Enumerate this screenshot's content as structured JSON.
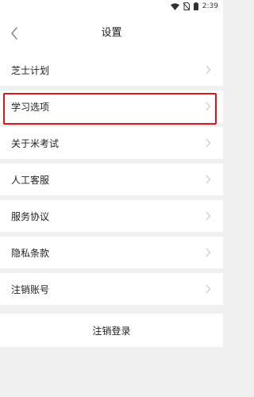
{
  "status_bar": {
    "time": "2:39",
    "icons": [
      "wifi-icon",
      "sim-off-icon",
      "battery-icon"
    ]
  },
  "header": {
    "title": "设置",
    "back_icon": "chevron-left-icon"
  },
  "settings": {
    "items": [
      {
        "label": "芝士计划"
      },
      {
        "label": "学习选项"
      },
      {
        "label": "关于米考试"
      },
      {
        "label": "人工客服"
      },
      {
        "label": "服务协议"
      },
      {
        "label": "隐私条款"
      },
      {
        "label": "注销账号"
      }
    ],
    "highlighted_index": 1,
    "chevron_icon": "chevron-right-icon"
  },
  "footer": {
    "logout_label": "注销登录"
  },
  "colors": {
    "highlight": "#e0141e",
    "background": "#f0f0f0",
    "surface": "#ffffff",
    "chevron": "#c8c8c8"
  }
}
